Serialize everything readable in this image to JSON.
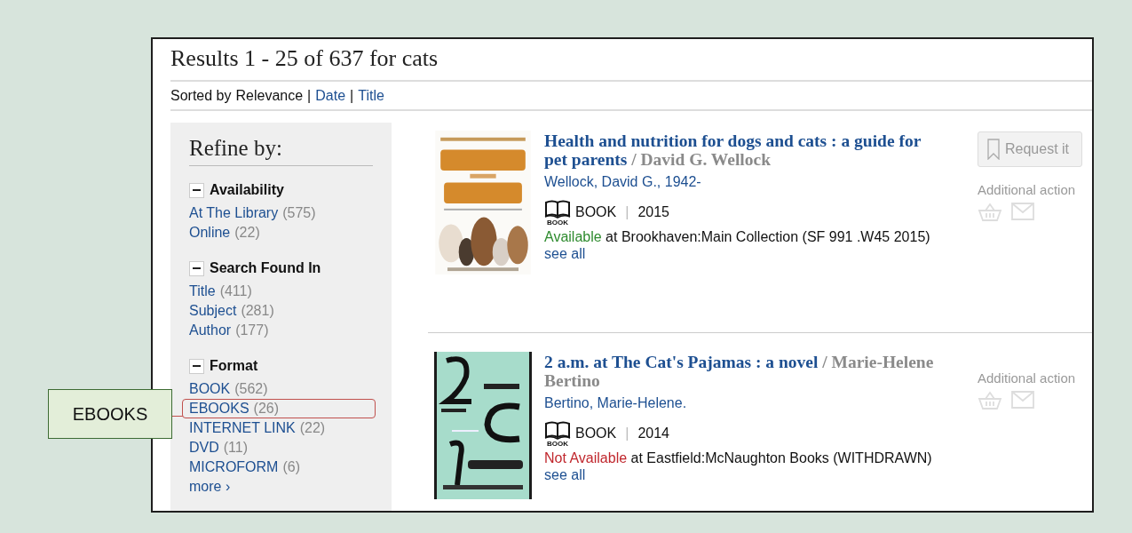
{
  "results_heading": "Results 1 - 25 of 637 for cats",
  "sort": {
    "label": "Sorted by",
    "separators": [
      "|",
      "|"
    ],
    "options": [
      {
        "label": "Relevance",
        "selected": true
      },
      {
        "label": "Date",
        "selected": false
      },
      {
        "label": "Title",
        "selected": false
      }
    ]
  },
  "refine": {
    "title": "Refine by:",
    "groups": [
      {
        "name": "Availability",
        "expanded": true,
        "items": [
          {
            "label": "At The Library",
            "count": "(575)",
            "highlighted": false
          },
          {
            "label": "Online",
            "count": "(22)",
            "highlighted": false
          }
        ]
      },
      {
        "name": "Search Found In",
        "expanded": true,
        "items": [
          {
            "label": "Title",
            "count": "(411)",
            "highlighted": false
          },
          {
            "label": "Subject",
            "count": "(281)",
            "highlighted": false
          },
          {
            "label": "Author",
            "count": "(177)",
            "highlighted": false
          }
        ]
      },
      {
        "name": "Format",
        "expanded": true,
        "items": [
          {
            "label": "BOOK",
            "count": "(562)",
            "highlighted": false
          },
          {
            "label": "EBOOKS",
            "count": "(26)",
            "highlighted": true
          },
          {
            "label": "INTERNET LINK",
            "count": "(22)",
            "highlighted": false
          },
          {
            "label": "DVD",
            "count": "(11)",
            "highlighted": false
          },
          {
            "label": "MICROFORM",
            "count": "(6)",
            "highlighted": false
          }
        ]
      }
    ],
    "more": "more ›"
  },
  "callout": {
    "label": "EBOOKS"
  },
  "results": [
    {
      "title": "Health and nutrition for dogs and cats : a guide for pet parents",
      "responsibility": "/ David G. Wellock",
      "author": "Wellock, David G., 1942-",
      "format_icon_label": "BOOK",
      "format": "BOOK",
      "separator": "|",
      "year": "2015",
      "availability": {
        "status": "Available",
        "available": true,
        "location": "at Brookhaven:Main Collection (SF 991 .W45 2015)"
      },
      "see_all": "see all",
      "request_button": "Request it",
      "additional_actions": "Additional action"
    },
    {
      "title": "2 a.m. at The Cat's Pajamas : a novel",
      "responsibility": "/ Marie-Helene Bertino",
      "author": "Bertino, Marie-Helene.",
      "format_icon_label": "BOOK",
      "format": "BOOK",
      "separator": "|",
      "year": "2014",
      "availability": {
        "status": "Not Available",
        "available": false,
        "location": "at Eastfield:McNaughton Books (WITHDRAWN)"
      },
      "see_all": "see all",
      "additional_actions": "Additional action"
    }
  ]
}
